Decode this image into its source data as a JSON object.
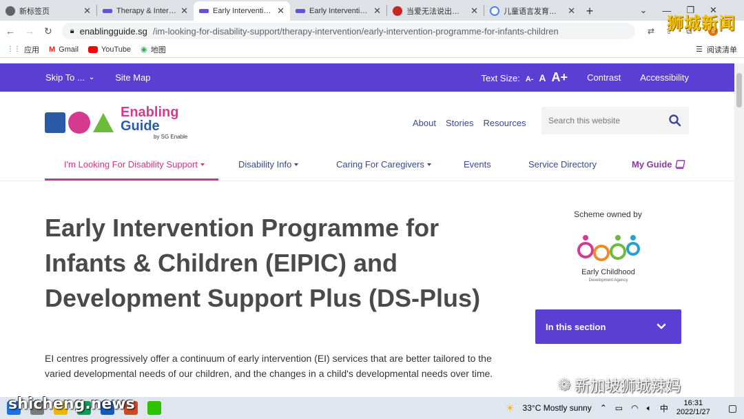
{
  "browser": {
    "tabs": [
      {
        "title": "新标签页",
        "favicon_color": "#5f6368"
      },
      {
        "title": "Therapy & Intervention",
        "favicon_color": "#6a4fd8"
      },
      {
        "title": "Early Intervention Programme",
        "favicon_color": "#6a4fd8"
      },
      {
        "title": "Early Intervention Programme",
        "favicon_color": "#6a4fd8"
      },
      {
        "title": "当爱无法说出口 亲子",
        "favicon_color": "#c62828"
      },
      {
        "title": "儿童语言发育迟缓",
        "favicon_color": "#4285f4"
      }
    ],
    "active_tab": 2,
    "url_host": "enablingguide.sg",
    "url_path": "/im-looking-for-disability-support/therapy-intervention/early-intervention-programme-for-infants-children",
    "bookmarks": [
      "应用",
      "Gmail",
      "YouTube",
      "地图"
    ],
    "reading_list": "阅读清单",
    "profile_badge": "6"
  },
  "site": {
    "utility": {
      "skip_to": "Skip To ...",
      "site_map": "Site Map",
      "text_size_label": "Text Size:",
      "text_size_small": "A-",
      "text_size_medium": "A",
      "text_size_large": "A+",
      "contrast": "Contrast",
      "accessibility": "Accessibility"
    },
    "logo": {
      "line1": "Enabling",
      "line2": "Guide",
      "line3": "by SG Enable"
    },
    "top_nav": [
      "About",
      "Stories",
      "Resources"
    ],
    "search_placeholder": "Search this website",
    "main_nav": [
      {
        "label": "I'm Looking For Disability Support",
        "dropdown": true
      },
      {
        "label": "Disability Info",
        "dropdown": true
      },
      {
        "label": "Caring For Caregivers",
        "dropdown": true
      },
      {
        "label": "Events",
        "dropdown": false
      },
      {
        "label": "Service Directory",
        "dropdown": false
      },
      {
        "label": "My Guide",
        "dropdown": false
      }
    ],
    "page_title": "Early Intervention Programme for Infants & Children (EIPIC) and Development Support Plus (DS-Plus)",
    "intro": "EI centres progressively offer a continuum of early intervention (EI) services that are better tailored to the varied developmental needs of our children, and the changes in a child's developmental needs over time.",
    "scheme_owned_by": "Scheme owned by",
    "agency_name": "Early Childhood",
    "agency_sub": "Development Agency",
    "in_this_section": "In this section"
  },
  "taskbar": {
    "weather": "33°C  Mostly sunny",
    "ime": "中",
    "time": "16:31",
    "date": "2022/1/27"
  },
  "watermarks": {
    "top_right": "狮城新闻",
    "bottom_left": "shicheng.news",
    "bottom_right": "新加坡狮城辣妈"
  },
  "colors": {
    "brand_purple": "#5b3fd4",
    "active_pink": "#c63a86",
    "nav_blue": "#3a4a8a"
  }
}
